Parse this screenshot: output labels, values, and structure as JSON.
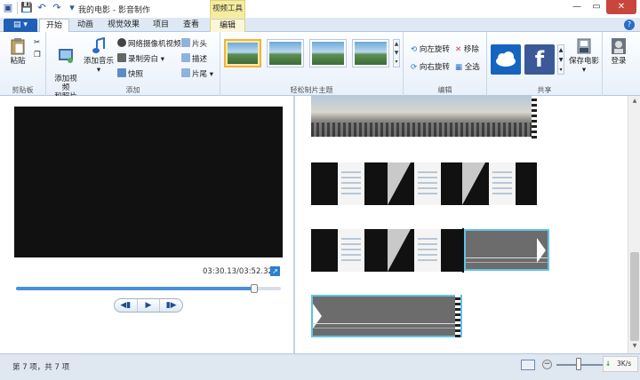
{
  "window": {
    "title": "我的电影 - 影音制作",
    "contextual_group": "视频工具"
  },
  "tabs": {
    "file": "▤ ▾",
    "items": [
      "开始",
      "动画",
      "视觉效果",
      "项目",
      "查看",
      "编辑"
    ]
  },
  "ribbon": {
    "clipboard": {
      "label": "剪贴板",
      "paste": "粘贴"
    },
    "add": {
      "label": "添加",
      "add_video": "添加视频\n和照片",
      "add_music": "添加音乐",
      "webcam": "网络摄像机视频",
      "record_narration": "录制旁白",
      "snapshot": "快照",
      "title": "片头",
      "caption": "描述",
      "credits": "片尾"
    },
    "themes": {
      "label": "轻松制片主题"
    },
    "editing": {
      "label": "编辑",
      "rotate_left": "向左旋转",
      "rotate_right": "向右旋转",
      "remove": "移除",
      "select_all": "全选"
    },
    "share": {
      "label": "共享",
      "save_movie": "保存电影"
    },
    "signin": "登录"
  },
  "preview": {
    "timecode": "03:30.13/03:52.32",
    "progress": 0.9
  },
  "status": {
    "text": "第 7 项，共 7 项",
    "net_speed": "3K/s"
  },
  "colors": {
    "accent": "#1f5fb8",
    "selected_clip": "#62c1e8",
    "theme_selected": "#f0b43a"
  }
}
